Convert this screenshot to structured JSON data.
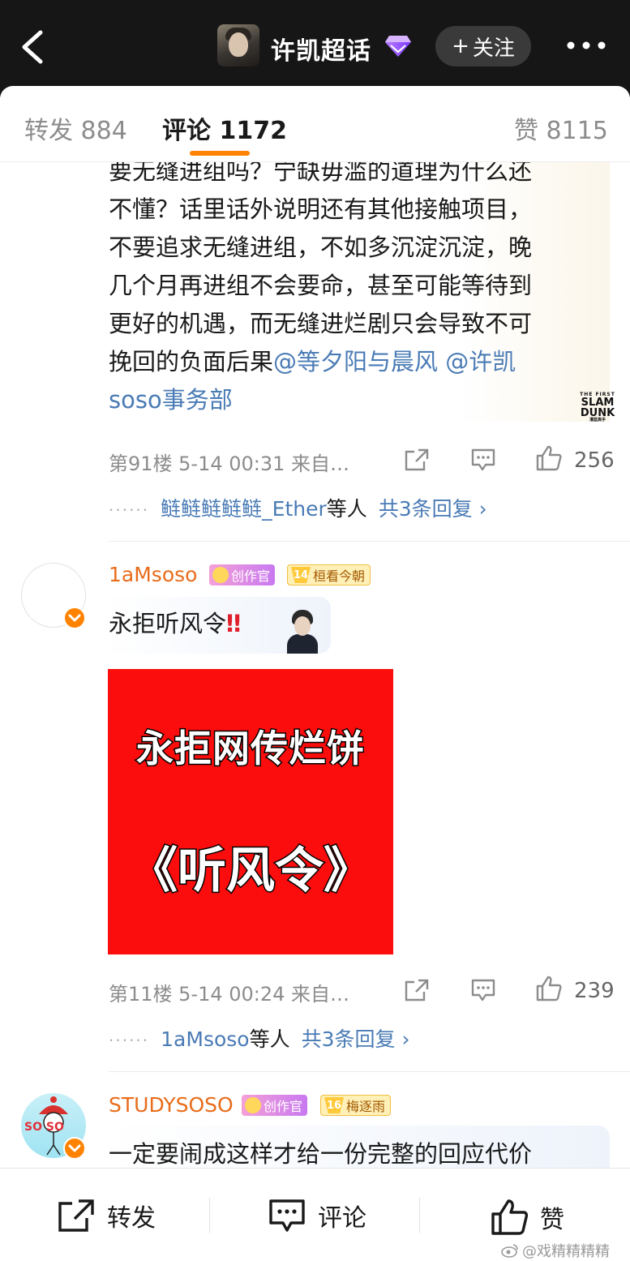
{
  "header": {
    "topic_title": "许凯超话",
    "follow_label": "关注",
    "follow_plus": "+"
  },
  "tabs": [
    {
      "label": "转发 884",
      "active": false
    },
    {
      "label": "评论 1172",
      "active": true
    },
    {
      "label": "赞 8115",
      "active": false
    }
  ],
  "comments": [
    {
      "text_lines": [
        "要无缝进组吗？宁缺毋滥的道理为什么还",
        "不懂？话里话外说明还有其他接触项目，",
        "不要追求无缝进组，不如多沉淀沉淀，晚",
        "几个月再进组不会要命，甚至可能等待到",
        "更好的机遇，而无缝进烂剧只会导致不可"
      ],
      "last_line_prefix": "挽回的负面后果",
      "mention_1": "@等夕阳与晨风",
      "mention_2a": " @许凯",
      "mention_2b": "soso事务部",
      "sticker": {
        "l1": "THE FIRST",
        "l2": "SLAM",
        "l3": "DUNK",
        "l4": "灌篮高手"
      },
      "meta": "第91楼  5-14 00:31  来自…",
      "likes": "256",
      "replies_who": "鲢鲢鲢鲢鲢_Ether",
      "replies_suffix": "等人",
      "replies_total": "共3条回复 ›"
    },
    {
      "username": "1aMsoso",
      "badge_creator": "创作官",
      "badge_fan_level": "14",
      "badge_fan_name": "桓看今朝",
      "text": "永拒听风令",
      "text_mark": "‼",
      "poster_line1": "永拒网传烂饼",
      "poster_line2": "《听风令》",
      "meta": "第11楼  5-14 00:24  来自…",
      "likes": "239",
      "replies_who": "1aMsoso",
      "replies_suffix": "等人",
      "replies_total": "共3条回复 ›"
    },
    {
      "username": "STUDYSOSO",
      "badge_creator": "创作官",
      "badge_fan_level": "16",
      "badge_fan_name": "梅逐雨",
      "avatar_text": "SO SO",
      "text": "一定要闹成这样才给一份完整的回应代价"
    }
  ],
  "bottom": {
    "repost": "转发",
    "comment": "评论",
    "like": "赞",
    "watermark": "@戏精精精精"
  },
  "colors": {
    "accent": "#ff8200",
    "mention": "#4a7bb5",
    "username": "#e86c1a",
    "poster_bg": "#fb0d0d"
  }
}
